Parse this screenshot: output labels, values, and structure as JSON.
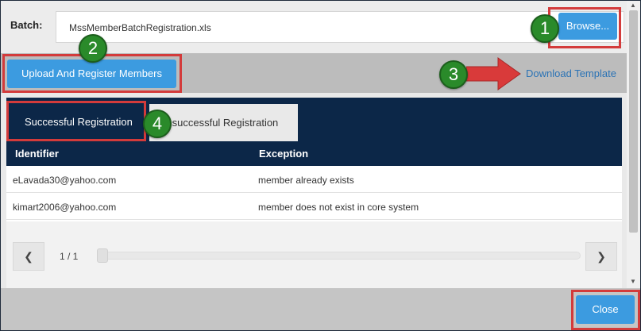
{
  "batch": {
    "label": "Batch:",
    "file_name": "MssMemberBatchRegistration.xls",
    "browse_label": "Browse..."
  },
  "toolbar": {
    "upload_label": "Upload And Register Members",
    "download_label": "Download Template"
  },
  "tabs": [
    {
      "label": "Successful Registration",
      "active": true
    },
    {
      "label": "Unsuccessful Registration",
      "active": false
    }
  ],
  "table": {
    "columns": [
      "Identifier",
      "Exception"
    ],
    "rows": [
      {
        "identifier": "eLavada30@yahoo.com",
        "exception": "member already exists"
      },
      {
        "identifier": "kimart2006@yahoo.com",
        "exception": "member does not exist in core system"
      }
    ]
  },
  "pager": {
    "text": "1 / 1",
    "prev_icon": "chevron-left-icon",
    "next_icon": "chevron-right-icon"
  },
  "footer": {
    "close_label": "Close"
  },
  "annotations": {
    "badges": [
      "1",
      "2",
      "3",
      "4"
    ],
    "highlight_color": "#d33b3b",
    "badge_color": "#2a8a2a"
  },
  "colors": {
    "primary": "#3c9be0",
    "header_navy": "#0c2748",
    "link": "#2b73b5"
  }
}
